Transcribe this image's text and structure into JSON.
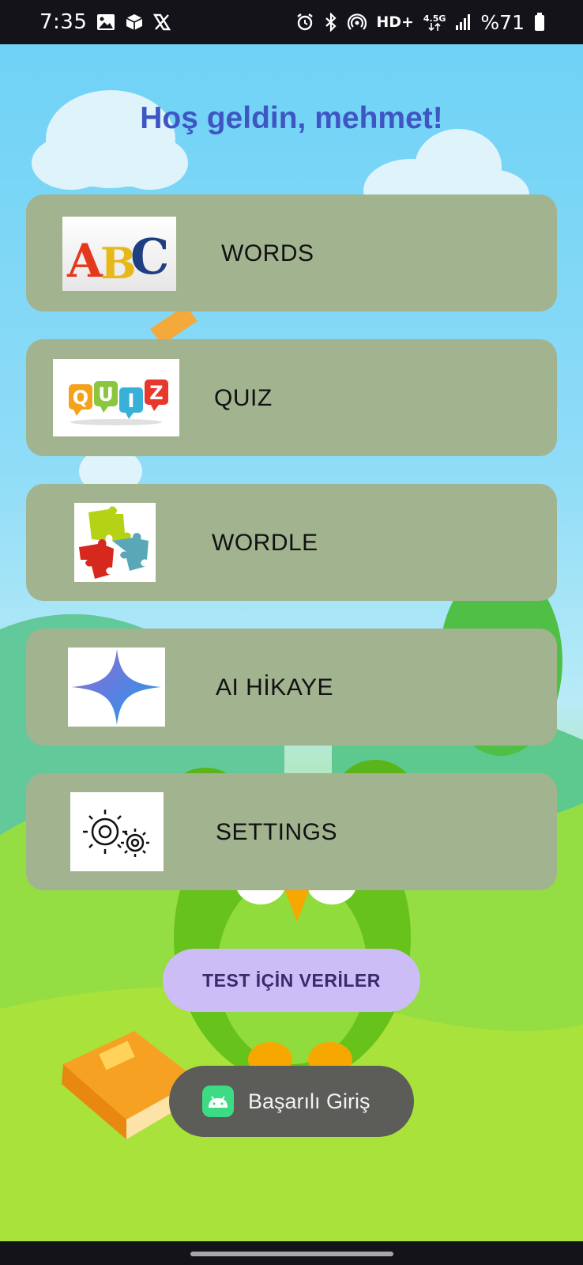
{
  "status_bar": {
    "time": "7:35",
    "left_icons": [
      "gallery-icon",
      "package-icon",
      "x-logo-icon"
    ],
    "right_icons": [
      "alarm-icon",
      "bluetooth-icon",
      "hotspot-icon",
      "hd-voice-icon",
      "network-4-5g-icon",
      "signal-icon",
      "battery-icon"
    ],
    "hd_label": "HD+",
    "network_label": "4.5G",
    "battery_text": "%71"
  },
  "main": {
    "greeting": "Hoş geldin, mehmet!",
    "menu": [
      {
        "id": "words",
        "label": "WORDS",
        "icon": "abc-letters-icon",
        "thumb_text": "ABC"
      },
      {
        "id": "quiz",
        "label": "QUIZ",
        "icon": "quiz-bubbles-icon",
        "thumb_text": [
          "Q",
          "U",
          "I",
          "Z"
        ]
      },
      {
        "id": "wordle",
        "label": "WORDLE",
        "icon": "puzzle-pieces-icon"
      },
      {
        "id": "ai-story",
        "label": "AI HİKAYE",
        "icon": "sparkle-star-icon"
      },
      {
        "id": "settings",
        "label": "SETTINGS",
        "icon": "gears-icon"
      }
    ],
    "test_button_label": "TEST İÇİN VERİLER"
  },
  "toast": {
    "icon": "android-icon",
    "text": "Başarılı Giriş"
  },
  "colors": {
    "title": "#3f55c4",
    "card": "#a2b390",
    "test_button": "#cdbdf7",
    "toast": "#5c5c58"
  }
}
